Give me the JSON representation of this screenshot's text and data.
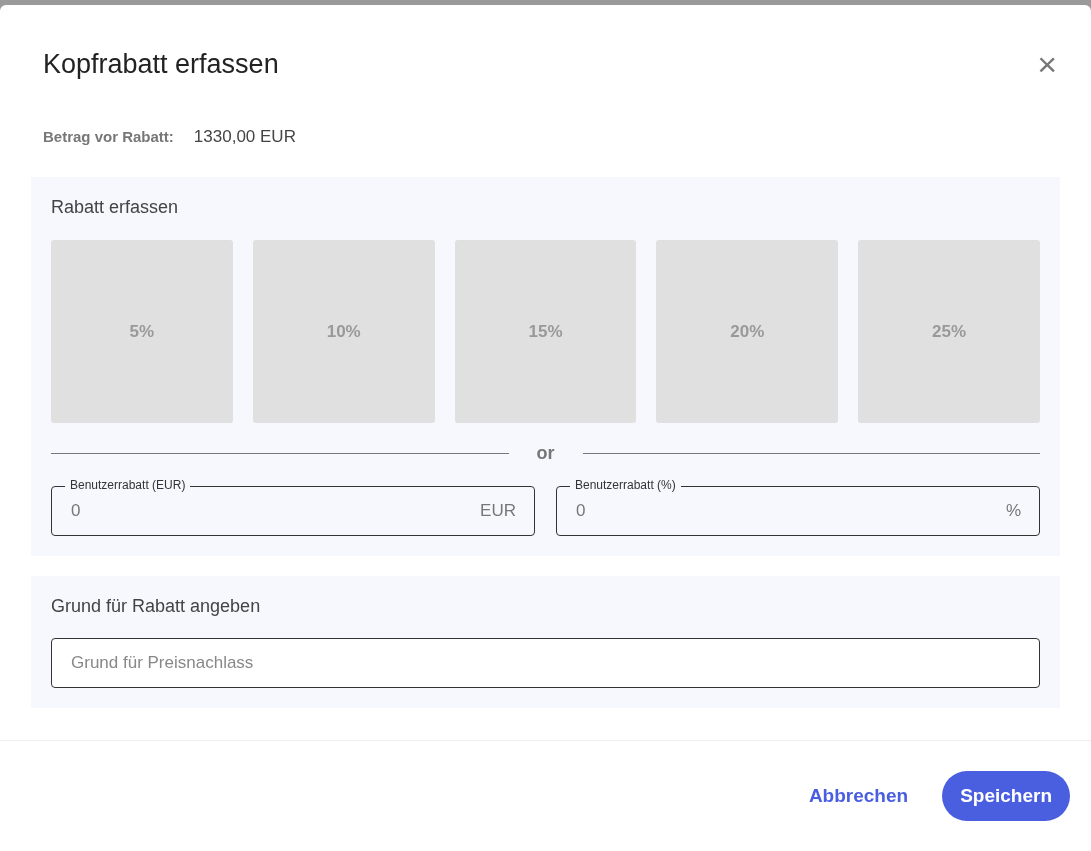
{
  "dialog": {
    "title": "Kopfrabatt erfassen",
    "close": "×"
  },
  "amount": {
    "label": "Betrag vor Rabatt:",
    "value": "1330,00 EUR"
  },
  "discount_section": {
    "heading": "Rabatt erfassen",
    "presets": [
      {
        "label": "5%",
        "selected": false
      },
      {
        "label": "10%",
        "selected": false
      },
      {
        "label": "15%",
        "selected": false
      },
      {
        "label": "20%",
        "selected": false
      },
      {
        "label": "25%",
        "selected": false
      }
    ],
    "divider": "or",
    "fields": [
      {
        "label": "Benutzerrabatt (EUR)",
        "placeholder": "0",
        "suffix": "EUR"
      },
      {
        "label": "Benutzerrabatt (%)",
        "placeholder": "0",
        "suffix": "%"
      }
    ]
  },
  "reason_section": {
    "heading": "Grund für Rabatt angeben",
    "placeholder": "Grund für Preisnachlass"
  },
  "buttons": {
    "cancel": "Abbrechen",
    "save": "Speichern"
  }
}
